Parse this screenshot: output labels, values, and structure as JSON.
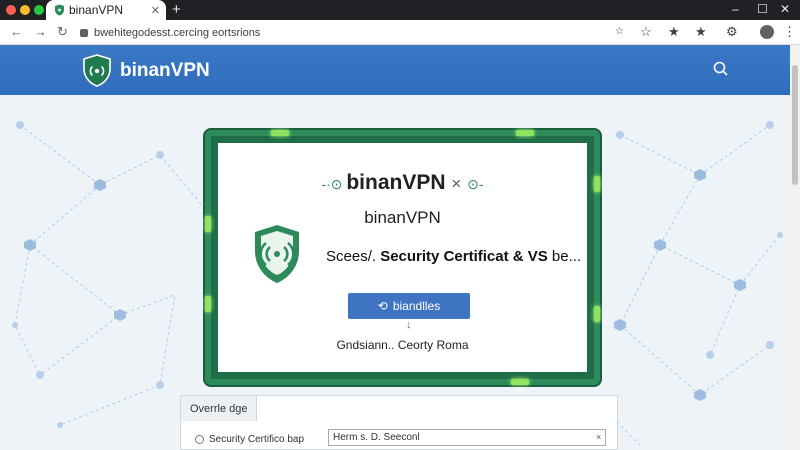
{
  "browser": {
    "tab_title": "binanVPN",
    "tab_close": "✕",
    "new_tab": "+",
    "address": "bwehitegodesst.cercing eortsrions",
    "window_controls": [
      "–",
      "☐",
      "✕"
    ]
  },
  "site": {
    "brand_name": "binanVPN",
    "accent_color": "#2f6cbb"
  },
  "card": {
    "title": "binanVPN",
    "title_suffix": "×",
    "subtitle": "binanVPN",
    "cert_prefix": "Scees/. ",
    "cert_main": "Security Certificat & VS",
    "cert_suffix": " be...",
    "button_label": "biandlles",
    "button_arrow": "↓",
    "caption": "Gndsiann.. Ceorty Roma",
    "frame_color": "#2d8a5a"
  },
  "override": {
    "tab_label": "Overrle dge",
    "row_label": "Security Certifico bap",
    "input_value": "Herm s. D. Seeconl",
    "input_clear": "×"
  },
  "icons": {
    "shield": "shield-wifi-icon",
    "search": "search-icon",
    "lock": "lock-icon"
  }
}
